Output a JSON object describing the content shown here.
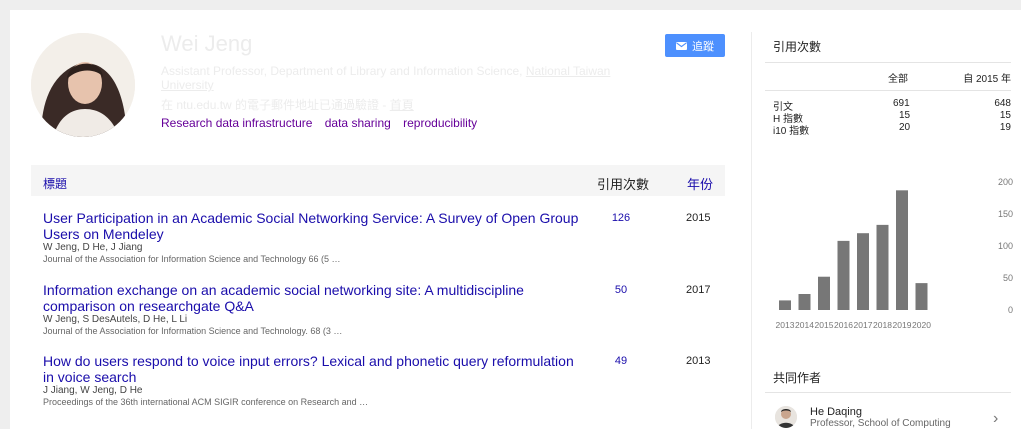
{
  "profile": {
    "name": "Wei Jeng",
    "affiliation": "Assistant Professor, Department of Library and Information Science, ",
    "affiliation_link": "National Taiwan University",
    "email_note": "在 ntu.edu.tw 的電子郵件地址已通過驗證",
    "homepage": "首頁",
    "interests": [
      "Research data infrastructure",
      "data sharing",
      "reproducibility"
    ],
    "follow_label": "追蹤"
  },
  "table": {
    "col_title": "標題",
    "col_cites": "引用次數",
    "col_year": "年份",
    "rows": [
      {
        "title": "User Participation in an Academic Social Networking Service: A Survey of Open Group Users on Mendeley",
        "authors": "W Jeng, D He, J Jiang",
        "venue": "Journal of the Association for Information Science and Technology 66 (5 …",
        "cites": "126",
        "year": "2015"
      },
      {
        "title": "Information exchange on an academic social networking site: A multidiscipline comparison on researchgate Q&A",
        "authors": "W Jeng, S DesAutels, D He, L Li",
        "venue": "Journal of the Association for Information Science and Technology. 68 (3 …",
        "cites": "50",
        "year": "2017"
      },
      {
        "title": "How do users respond to voice input errors? Lexical and phonetic query reformulation in voice search",
        "authors": "J Jiang, W Jeng, D He",
        "venue": "Proceedings of the 36th international ACM SIGIR conference on Research and …",
        "cites": "49",
        "year": "2013"
      }
    ]
  },
  "citations": {
    "heading": "引用次數",
    "col_all": "全部",
    "col_since": "自 2015 年",
    "rows": [
      {
        "label": "引文",
        "all": "691",
        "since": "648"
      },
      {
        "label": "H 指數",
        "all": "15",
        "since": "15"
      },
      {
        "label": "i10 指數",
        "all": "20",
        "since": "19"
      }
    ]
  },
  "chart_data": {
    "type": "bar",
    "categories": [
      "2013",
      "2014",
      "2015",
      "2016",
      "2017",
      "2018",
      "2019",
      "2020"
    ],
    "values": [
      15,
      25,
      52,
      108,
      120,
      133,
      187,
      42
    ],
    "ylim": [
      0,
      200
    ],
    "yticks": [
      "200",
      "150",
      "100",
      "50",
      "0"
    ],
    "grid": false,
    "bar_color": "#777777"
  },
  "coauthors": {
    "heading": "共同作者",
    "items": [
      {
        "name": "He Daqing",
        "role": "Professor, School of Computing"
      }
    ]
  },
  "colors": {
    "link": "#1a0dab",
    "interest": "#660099",
    "follow": "#4d90fe"
  }
}
